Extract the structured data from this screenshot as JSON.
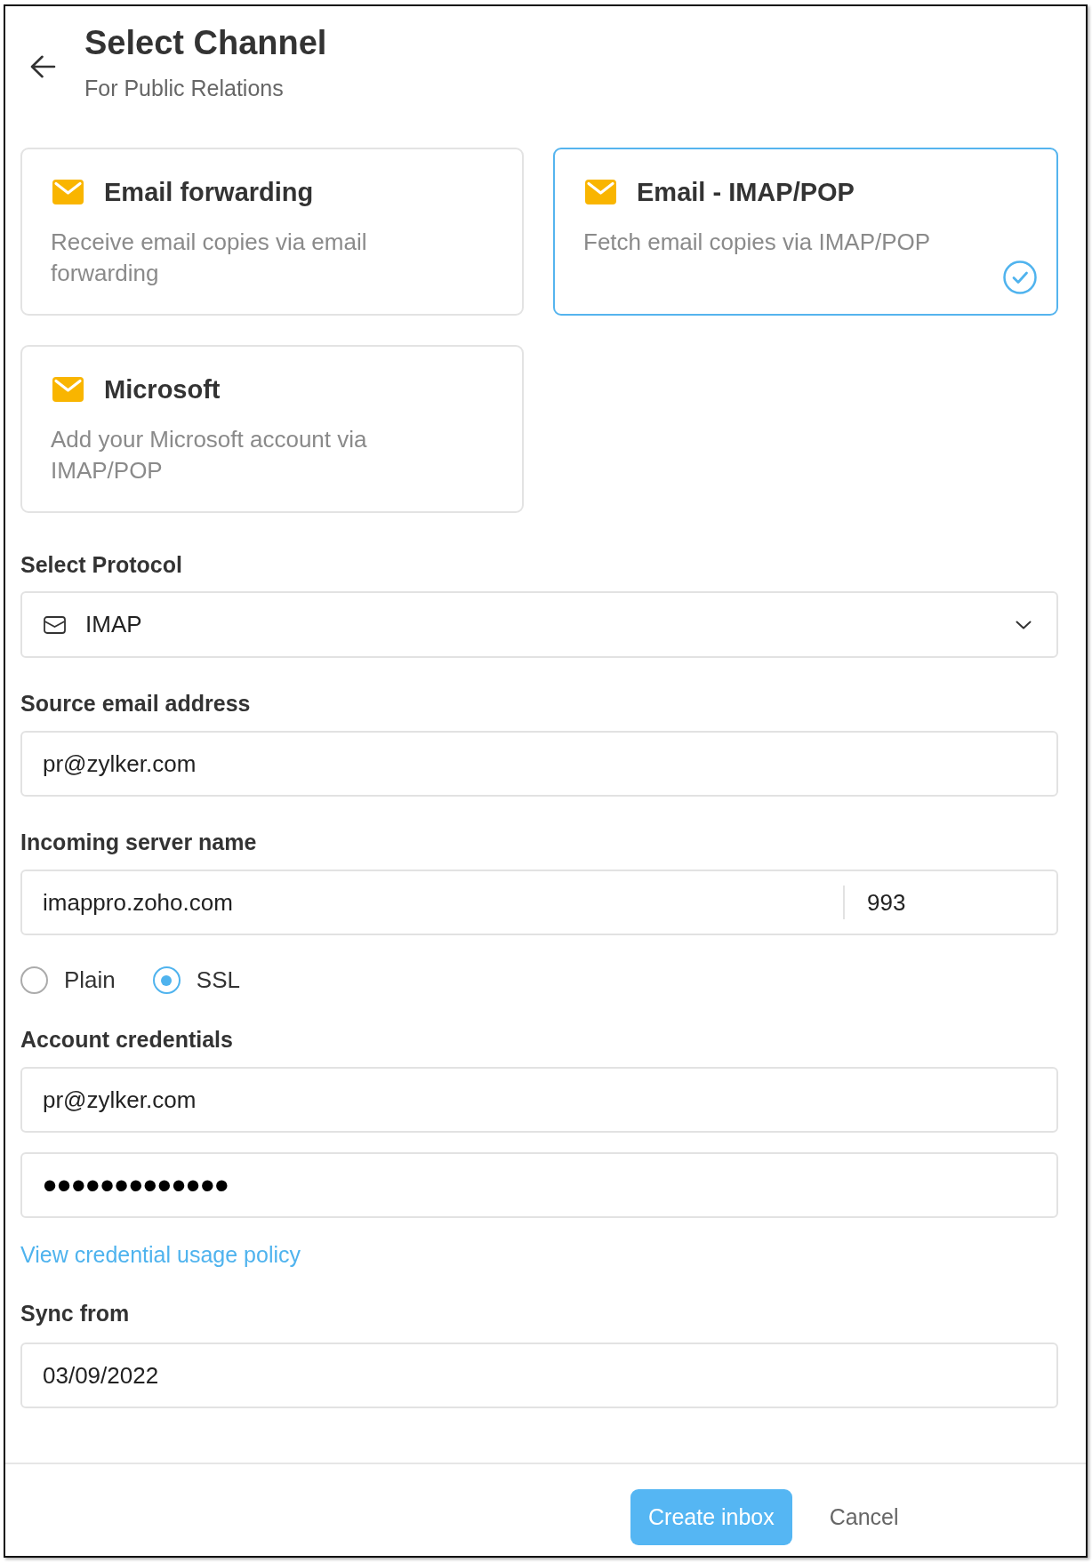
{
  "header": {
    "title": "Select Channel",
    "subtitle": "For Public Relations"
  },
  "channels": [
    {
      "title": "Email forwarding",
      "description": "Receive email copies via email forwarding",
      "selected": false
    },
    {
      "title": "Email - IMAP/POP",
      "description": "Fetch email copies via IMAP/POP",
      "selected": true
    },
    {
      "title": "Microsoft",
      "description": "Add your Microsoft account via IMAP/POP",
      "selected": false
    }
  ],
  "protocol": {
    "label": "Select Protocol",
    "value": "IMAP"
  },
  "source_email": {
    "label": "Source email address",
    "value": "pr@zylker.com"
  },
  "incoming_server": {
    "label": "Incoming server name",
    "host": "imappro.zoho.com",
    "port": "993"
  },
  "security_options": [
    {
      "label": "Plain",
      "selected": false
    },
    {
      "label": "SSL",
      "selected": true
    }
  ],
  "credentials": {
    "label": "Account credentials",
    "username": "pr@zylker.com",
    "password": "•••••••••••••"
  },
  "policy_link": "View credential usage policy",
  "sync_from": {
    "label": "Sync from",
    "value": "03/09/2022"
  },
  "buttons": [
    {
      "label": "Create inbox",
      "kind": "primary"
    },
    {
      "label": "Cancel",
      "kind": "secondary"
    }
  ]
}
